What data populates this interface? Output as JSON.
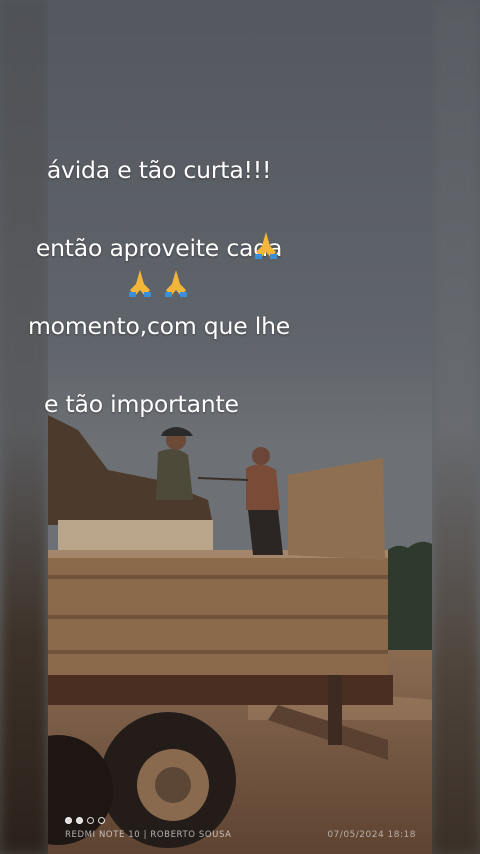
{
  "caption": {
    "lines": [
      "ávida e tão curta!!!",
      "então aproveite cada",
      "momento,com que lhe",
      "e tão importante"
    ]
  },
  "emojis": [
    {
      "name": "folded-hands-icon",
      "glyph": "🙏"
    },
    {
      "name": "folded-hands-icon",
      "glyph": "🙏"
    },
    {
      "name": "folded-hands-icon",
      "glyph": "🙏"
    }
  ],
  "photo": {
    "description_tag": "truck-photo",
    "sky_color": "#5e6268",
    "truck_color": "#8a6a4a",
    "ground_color": "#7a5a3f"
  },
  "watermark": {
    "device_text": "REDMI NOTE 10 | ROBERTO SOUSA",
    "date_text": "07/05/2024  18:18",
    "page_dots": [
      true,
      true,
      false,
      false
    ]
  }
}
